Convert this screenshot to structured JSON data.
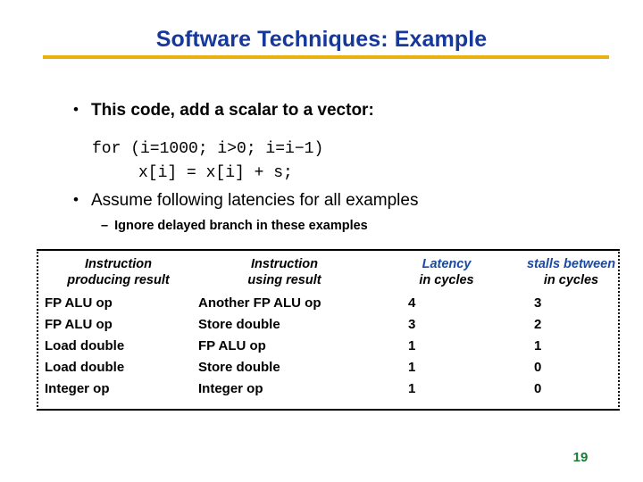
{
  "slide": {
    "title": "Software Techniques: Example",
    "page_number": "19",
    "accent_rule_color": "#e8b010",
    "title_color": "#17389b",
    "page_number_color": "#1b7a33"
  },
  "body": {
    "bullet1": {
      "marker": "•",
      "text": "This code, add a scalar to a vector:"
    },
    "code": {
      "line1": "for (i=1000; i>0; i=i−1)",
      "line2": "x[i] = x[i] + s;"
    },
    "bullet2": {
      "marker": "•",
      "text": "Assume following latencies for all examples"
    },
    "subbullet": {
      "marker": "–",
      "text": "Ignore delayed branch in these examples"
    }
  },
  "latency_table": {
    "headers": [
      {
        "line1": "Instruction",
        "line2": "producing result",
        "line1_color": "#000000"
      },
      {
        "line1": "Instruction",
        "line2": "using result",
        "line1_color": "#000000"
      },
      {
        "line1": "Latency",
        "line2": "in cycles",
        "line1_color": "#1a4aa4"
      },
      {
        "line1": "stalls between",
        "line2": "in cycles",
        "line1_color": "#1a4aa4"
      }
    ],
    "rows": [
      {
        "producing": "FP ALU op",
        "using": "Another FP ALU op",
        "latency": "4",
        "stalls": "3"
      },
      {
        "producing": "FP ALU op",
        "using": "Store double",
        "latency": "3",
        "stalls": "2"
      },
      {
        "producing": "Load double",
        "using": "FP ALU op",
        "latency": "1",
        "stalls": "1"
      },
      {
        "producing": "Load double",
        "using": "Store double",
        "latency": "1",
        "stalls": "0"
      },
      {
        "producing": "Integer op",
        "using": "Integer op",
        "latency": "1",
        "stalls": "0"
      }
    ]
  }
}
